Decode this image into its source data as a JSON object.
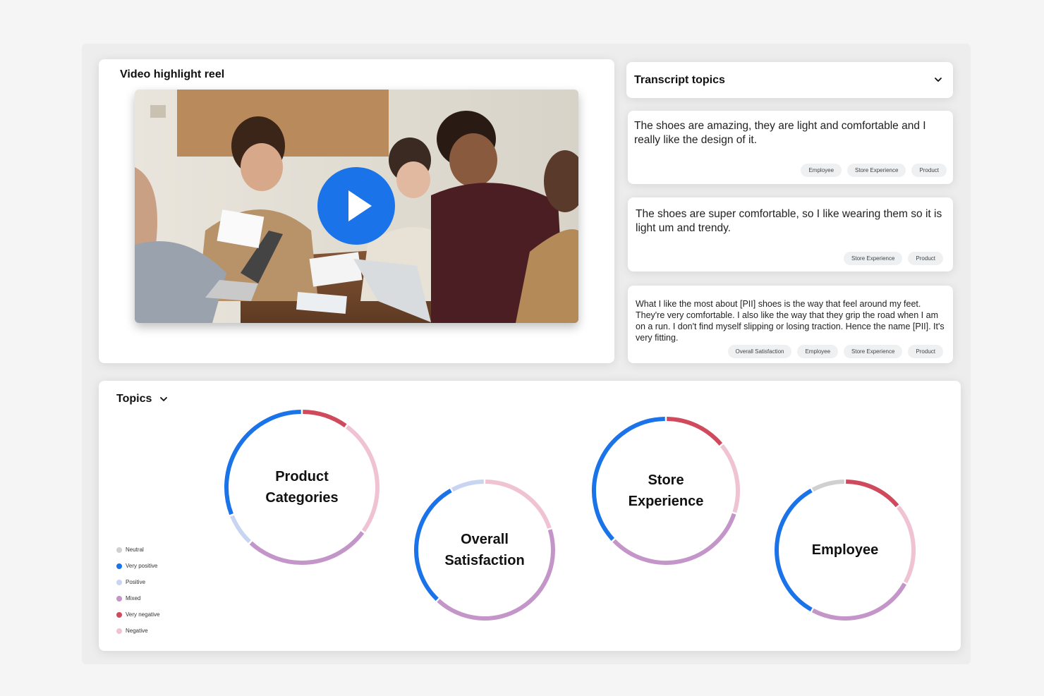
{
  "colors": {
    "neutral": "#d0d0d0",
    "very_positive": "#1a73e8",
    "positive": "#c8d5f2",
    "mixed": "#c495c8",
    "very_negative": "#d04a5e",
    "negative": "#efc3d3",
    "play": "#1a73e8"
  },
  "video": {
    "title": "Video highlight reel",
    "play_icon": "play-icon"
  },
  "transcript": {
    "title": "Transcript topics",
    "chevron_icon": "chevron-down-icon",
    "quotes": [
      {
        "text": "The shoes are amazing, they are light and comfortable and I really like the design of it.",
        "tags": [
          "Employee",
          "Store Experience",
          "Product"
        ]
      },
      {
        "text": "The shoes are super comfortable, so I like wearing them so it is light um and trendy.",
        "tags": [
          "Store Experience",
          "Product"
        ]
      },
      {
        "text": "What I like the most about [PII] shoes is the way that feel around my feet. They're very comfortable. I also like the way that they grip the road when I am on a run. I don't find myself slipping or losing traction. Hence the name [PII]. It's very fitting.",
        "tags": [
          "Overall Satisfaction",
          "Employee",
          "Store Experience",
          "Product"
        ]
      }
    ]
  },
  "topics": {
    "title": "Topics",
    "chevron_icon": "chevron-down-icon",
    "legend": [
      {
        "label": "Neutral",
        "key": "neutral"
      },
      {
        "label": "Very positive",
        "key": "very_positive"
      },
      {
        "label": "Positive",
        "key": "positive"
      },
      {
        "label": "Mixed",
        "key": "mixed"
      },
      {
        "label": "Very negative",
        "key": "very_negative"
      },
      {
        "label": "Negative",
        "key": "negative"
      }
    ],
    "donuts": [
      {
        "label": "Product Categories",
        "segments": [
          {
            "key": "very_negative",
            "pct": 10
          },
          {
            "key": "negative",
            "pct": 25
          },
          {
            "key": "mixed",
            "pct": 27
          },
          {
            "key": "positive",
            "pct": 7
          },
          {
            "key": "very_positive",
            "pct": 31
          }
        ]
      },
      {
        "label": "Overall Satisfaction",
        "segments": [
          {
            "key": "negative",
            "pct": 20
          },
          {
            "key": "mixed",
            "pct": 42
          },
          {
            "key": "very_positive",
            "pct": 30
          },
          {
            "key": "positive",
            "pct": 8
          }
        ]
      },
      {
        "label": "Store Experience",
        "segments": [
          {
            "key": "very_negative",
            "pct": 14
          },
          {
            "key": "negative",
            "pct": 16
          },
          {
            "key": "mixed",
            "pct": 33
          },
          {
            "key": "very_positive",
            "pct": 37
          }
        ]
      },
      {
        "label": "Employee",
        "segments": [
          {
            "key": "very_negative",
            "pct": 14
          },
          {
            "key": "negative",
            "pct": 19
          },
          {
            "key": "mixed",
            "pct": 25
          },
          {
            "key": "very_positive",
            "pct": 34
          },
          {
            "key": "neutral",
            "pct": 8
          }
        ]
      }
    ]
  }
}
